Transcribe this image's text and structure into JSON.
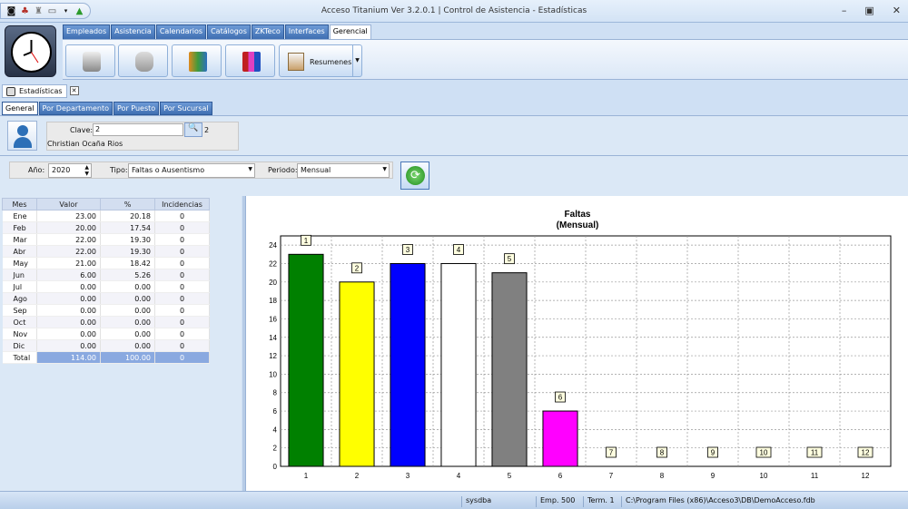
{
  "window": {
    "title": "Acceso Titanium  Ver 3.2.0.1 | Control de Asistencia - Estadísticas"
  },
  "ribbon_tabs": [
    {
      "label": "Empleados"
    },
    {
      "label": "Asistencia"
    },
    {
      "label": "Calendarios"
    },
    {
      "label": "Catálogos"
    },
    {
      "label": "ZKTeco"
    },
    {
      "label": "Interfaces"
    },
    {
      "label": "Gerencial"
    }
  ],
  "ribbon": {
    "resumenes_label": "Resumenes"
  },
  "doc_tab": {
    "label": "Estadísticas"
  },
  "sub_tabs": [
    {
      "label": "General"
    },
    {
      "label": "Por Departamento"
    },
    {
      "label": "Por Puesto"
    },
    {
      "label": "Por Sucursal"
    }
  ],
  "employee": {
    "clave_label": "Clave:",
    "clave_value": "2",
    "code": "2",
    "name": "Christian Ocaña Rios"
  },
  "filters": {
    "anio_label": "Año:",
    "anio_value": "2020",
    "tipo_label": "Tipo:",
    "tipo_value": "Faltas o Ausentismo",
    "periodo_label": "Periodo:",
    "periodo_value": "Mensual"
  },
  "table": {
    "headers": [
      "Mes",
      "Valor",
      "%",
      "Incidencias"
    ],
    "rows": [
      [
        "Ene",
        "23.00",
        "20.18",
        "0"
      ],
      [
        "Feb",
        "20.00",
        "17.54",
        "0"
      ],
      [
        "Mar",
        "22.00",
        "19.30",
        "0"
      ],
      [
        "Abr",
        "22.00",
        "19.30",
        "0"
      ],
      [
        "May",
        "21.00",
        "18.42",
        "0"
      ],
      [
        "Jun",
        "6.00",
        "5.26",
        "0"
      ],
      [
        "Jul",
        "0.00",
        "0.00",
        "0"
      ],
      [
        "Ago",
        "0.00",
        "0.00",
        "0"
      ],
      [
        "Sep",
        "0.00",
        "0.00",
        "0"
      ],
      [
        "Oct",
        "0.00",
        "0.00",
        "0"
      ],
      [
        "Nov",
        "0.00",
        "0.00",
        "0"
      ],
      [
        "Dic",
        "0.00",
        "0.00",
        "0"
      ]
    ],
    "total": [
      "Total",
      "114.00",
      "100.00",
      "0"
    ]
  },
  "chart_data": {
    "type": "bar",
    "title": "Faltas",
    "subtitle": "(Mensual)",
    "categories": [
      "1",
      "2",
      "3",
      "4",
      "5",
      "6",
      "7",
      "8",
      "9",
      "10",
      "11",
      "12"
    ],
    "values": [
      23,
      20,
      22,
      22,
      21,
      6,
      0,
      0,
      0,
      0,
      0,
      0
    ],
    "data_labels": [
      "1",
      "2",
      "3",
      "4",
      "5",
      "6",
      "7",
      "8",
      "9",
      "10",
      "11",
      "12"
    ],
    "colors": [
      "#008000",
      "#ffff00",
      "#0000ff",
      "#ffffff",
      "#808080",
      "#ff00ff",
      "#ff0000",
      "#00ffff",
      "#800000",
      "#000080",
      "#808000",
      "#800080"
    ],
    "ylim": [
      0,
      25
    ],
    "yticks": [
      0,
      2,
      4,
      6,
      8,
      10,
      12,
      14,
      16,
      18,
      20,
      22,
      24
    ],
    "grid": true,
    "legend": false
  },
  "status": {
    "user": "sysdba",
    "emp": "Emp. 500",
    "term": "Term. 1",
    "path": "C:\\Program Files (x86)\\Acceso3\\DB\\DemoAcceso.fdb"
  }
}
